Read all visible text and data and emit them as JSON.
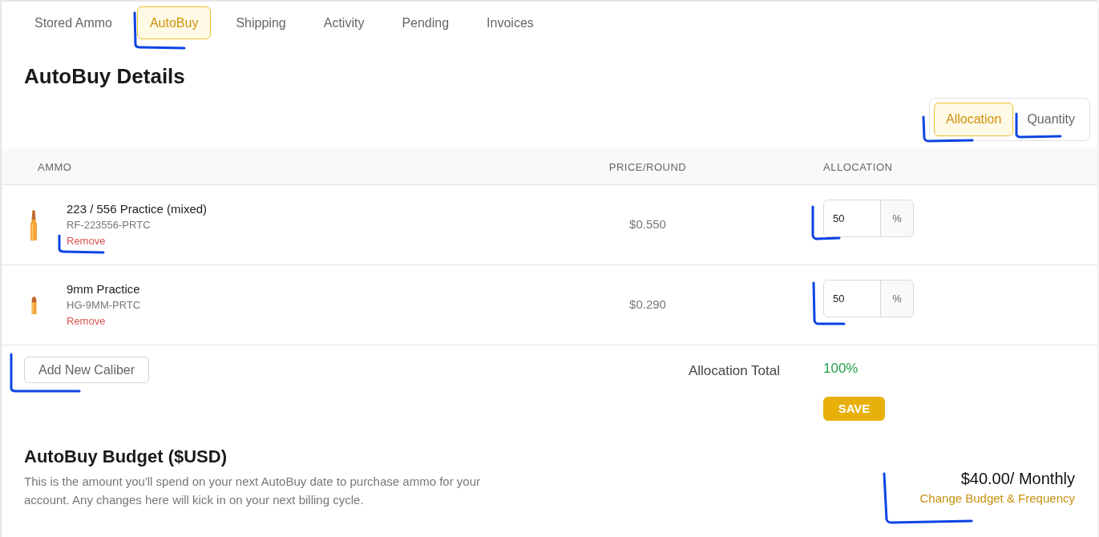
{
  "tabs": [
    {
      "label": "Stored Ammo",
      "selected": false
    },
    {
      "label": "AutoBuy",
      "selected": true
    },
    {
      "label": "Shipping",
      "selected": false
    },
    {
      "label": "Activity",
      "selected": false
    },
    {
      "label": "Pending",
      "selected": false
    },
    {
      "label": "Invoices",
      "selected": false
    }
  ],
  "details": {
    "title": "AutoBuy Details",
    "mode_toggle": [
      {
        "label": "Allocation",
        "selected": true
      },
      {
        "label": "Quantity",
        "selected": false
      }
    ]
  },
  "table": {
    "columns": [
      "AMMO",
      "PRICE/ROUND",
      "ALLOCATION"
    ],
    "rows": [
      {
        "kind": "rifle",
        "name": "223 / 556 Practice (mixed)",
        "sku": "RF-223556-PRTC",
        "remove": "Remove",
        "price": "$0.550",
        "allocation": "50",
        "unit": "%"
      },
      {
        "kind": "pistol",
        "name": "9mm Practice",
        "sku": "HG-9MM-PRTC",
        "remove": "Remove",
        "price": "$0.290",
        "allocation": "50",
        "unit": "%"
      }
    ]
  },
  "add_button": "Add New Caliber",
  "total": {
    "label": "Allocation Total",
    "value": "100%"
  },
  "save_button": "SAVE",
  "budget": {
    "title": "AutoBuy Budget ($USD)",
    "description": "This is the amount you'll spend on your next AutoBuy date to purchase ammo for your account. Any changes here will kick in on your next billing cycle.",
    "amount": "$40.00/ Monthly",
    "link": "Change Budget & Frequency"
  }
}
